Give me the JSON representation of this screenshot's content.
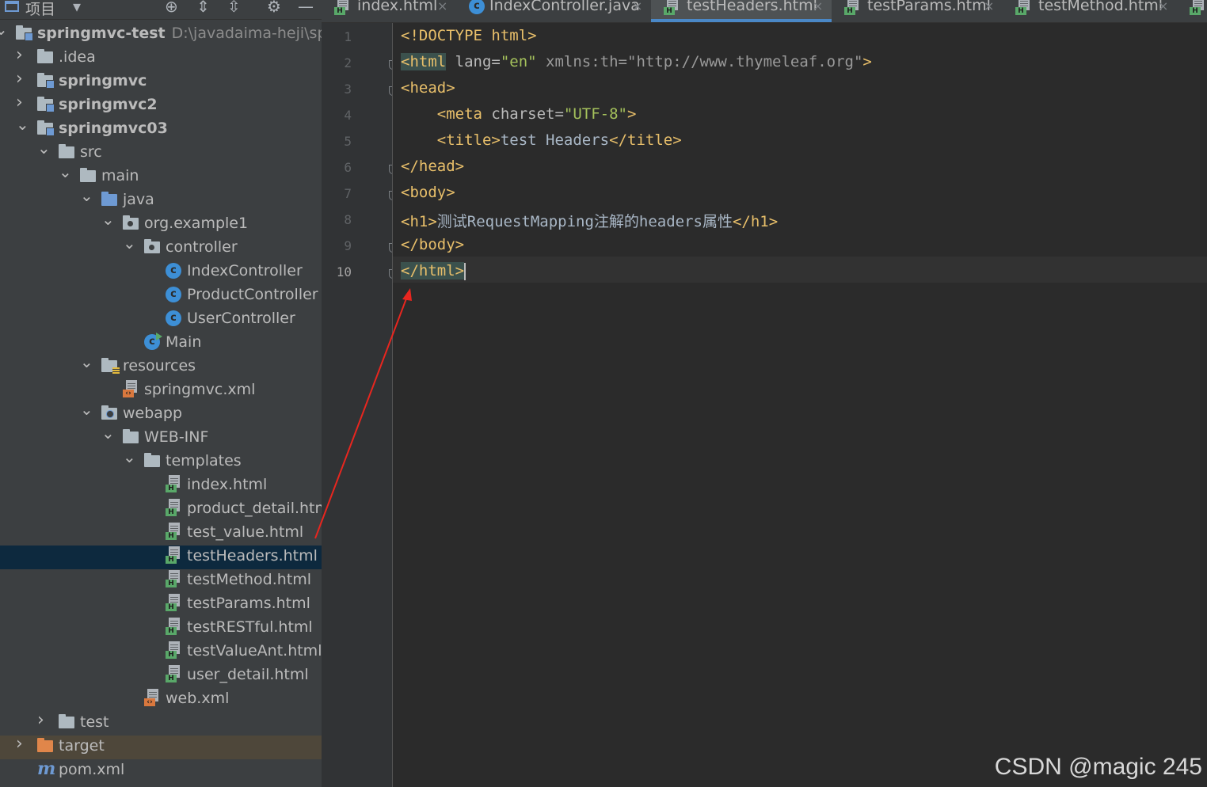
{
  "project_panel": {
    "title": "项目",
    "tree": [
      {
        "label": "springmvc-test",
        "hint": "D:\\javadaima-heji\\spring",
        "bold": true
      },
      {
        "label": ".idea"
      },
      {
        "label": "springmvc",
        "bold": true
      },
      {
        "label": "springmvc2",
        "bold": true
      },
      {
        "label": "springmvc03",
        "bold": true
      },
      {
        "label": "src"
      },
      {
        "label": "main"
      },
      {
        "label": "java"
      },
      {
        "label": "org.example1"
      },
      {
        "label": "controller"
      },
      {
        "label": "IndexController"
      },
      {
        "label": "ProductController"
      },
      {
        "label": "UserController"
      },
      {
        "label": "Main"
      },
      {
        "label": "resources"
      },
      {
        "label": "springmvc.xml"
      },
      {
        "label": "webapp"
      },
      {
        "label": "WEB-INF"
      },
      {
        "label": "templates"
      },
      {
        "label": "index.html"
      },
      {
        "label": "product_detail.html"
      },
      {
        "label": "test_value.html"
      },
      {
        "label": "testHeaders.html",
        "selected": true
      },
      {
        "label": "testMethod.html"
      },
      {
        "label": "testParams.html"
      },
      {
        "label": "testRESTful.html"
      },
      {
        "label": "testValueAnt.html"
      },
      {
        "label": "user_detail.html"
      },
      {
        "label": "web.xml"
      },
      {
        "label": "test"
      },
      {
        "label": "target"
      },
      {
        "label": "pom.xml"
      }
    ]
  },
  "tabs": [
    {
      "label": "index.html"
    },
    {
      "label": "IndexController.java"
    },
    {
      "label": "testHeaders.html",
      "active": true
    },
    {
      "label": "testParams.html"
    },
    {
      "label": "testMethod.html"
    }
  ],
  "editor": {
    "line_numbers": [
      "1",
      "2",
      "3",
      "4",
      "5",
      "6",
      "7",
      "8",
      "9",
      "10"
    ],
    "current_line": "10",
    "lines": [
      [
        {
          "t": "<!DOCTYPE html>",
          "c": "tag"
        }
      ],
      [
        {
          "t": "<html",
          "c": "tag hl"
        },
        {
          "t": " lang=",
          "c": "attr"
        },
        {
          "t": "\"en\"",
          "c": "val"
        },
        {
          "t": " xmlns:th=",
          "c": "ns"
        },
        {
          "t": "\"http://www.thymeleaf.org\"",
          "c": "ns"
        },
        {
          "t": ">",
          "c": "tag"
        }
      ],
      [
        {
          "t": "<head>",
          "c": "tag"
        }
      ],
      [
        {
          "t": "    <meta",
          "c": "tag"
        },
        {
          "t": " charset=",
          "c": "attr"
        },
        {
          "t": "\"UTF-8\"",
          "c": "val"
        },
        {
          "t": ">",
          "c": "tag"
        }
      ],
      [
        {
          "t": "    <title>",
          "c": "tag"
        },
        {
          "t": "test Headers",
          "c": "txt"
        },
        {
          "t": "</title>",
          "c": "tag"
        }
      ],
      [
        {
          "t": "</head>",
          "c": "tag"
        }
      ],
      [
        {
          "t": "<body>",
          "c": "tag"
        }
      ],
      [
        {
          "t": "<h1>",
          "c": "tag"
        },
        {
          "t": "测试RequestMapping注解的headers属性",
          "c": "txt"
        },
        {
          "t": "</h1>",
          "c": "tag"
        }
      ],
      [
        {
          "t": "</body>",
          "c": "tag"
        }
      ],
      [
        {
          "t": "</html>",
          "c": "tag hl"
        }
      ]
    ]
  },
  "watermark": "CSDN @magic 245",
  "colors": {
    "annotation_arrow": "#e8261f",
    "selection": "#0d293e",
    "tab_underline": "#4a88c7"
  }
}
